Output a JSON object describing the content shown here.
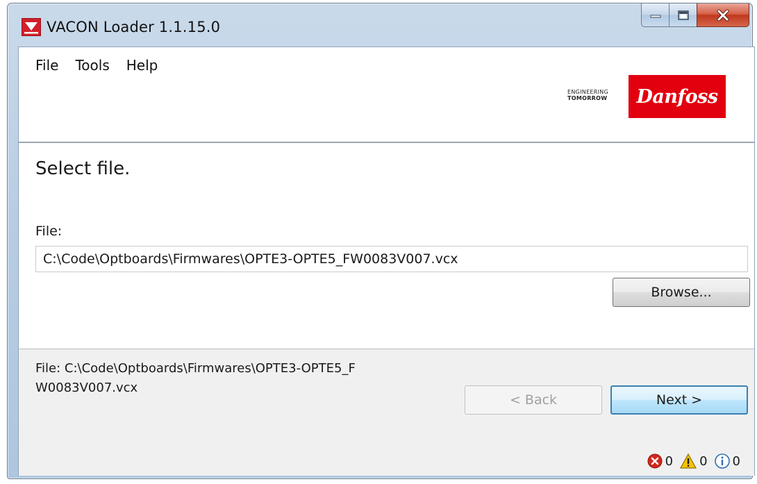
{
  "window": {
    "title": "VACON Loader 1.1.15.0"
  },
  "menu": {
    "items": [
      "File",
      "Tools",
      "Help"
    ]
  },
  "logo": {
    "tagline_line1": "ENGINEERING",
    "tagline_line2": "TOMORROW",
    "brand": "Danfoss",
    "brand_color": "#e2000f"
  },
  "page": {
    "title": "Select file.",
    "file_label": "File:",
    "file_value": "C:\\Code\\Optboards\\Firmwares\\OPTE3-OPTE5_FW0083V007.vcx",
    "browse_label": "Browse..."
  },
  "footer": {
    "status": "File: C:\\Code\\Optboards\\Firmwares\\OPTE3-OPTE5_FW0083V007.vcx",
    "back_label": "< Back",
    "next_label": "Next >",
    "error_count": "0",
    "warning_count": "0",
    "info_count": "0"
  },
  "icons": {
    "app": "vacon-app-icon",
    "minimize": "minimize-icon",
    "maximize": "maximize-icon",
    "close": "close-icon",
    "error": "error-icon",
    "warning": "warning-icon",
    "info": "info-icon"
  }
}
